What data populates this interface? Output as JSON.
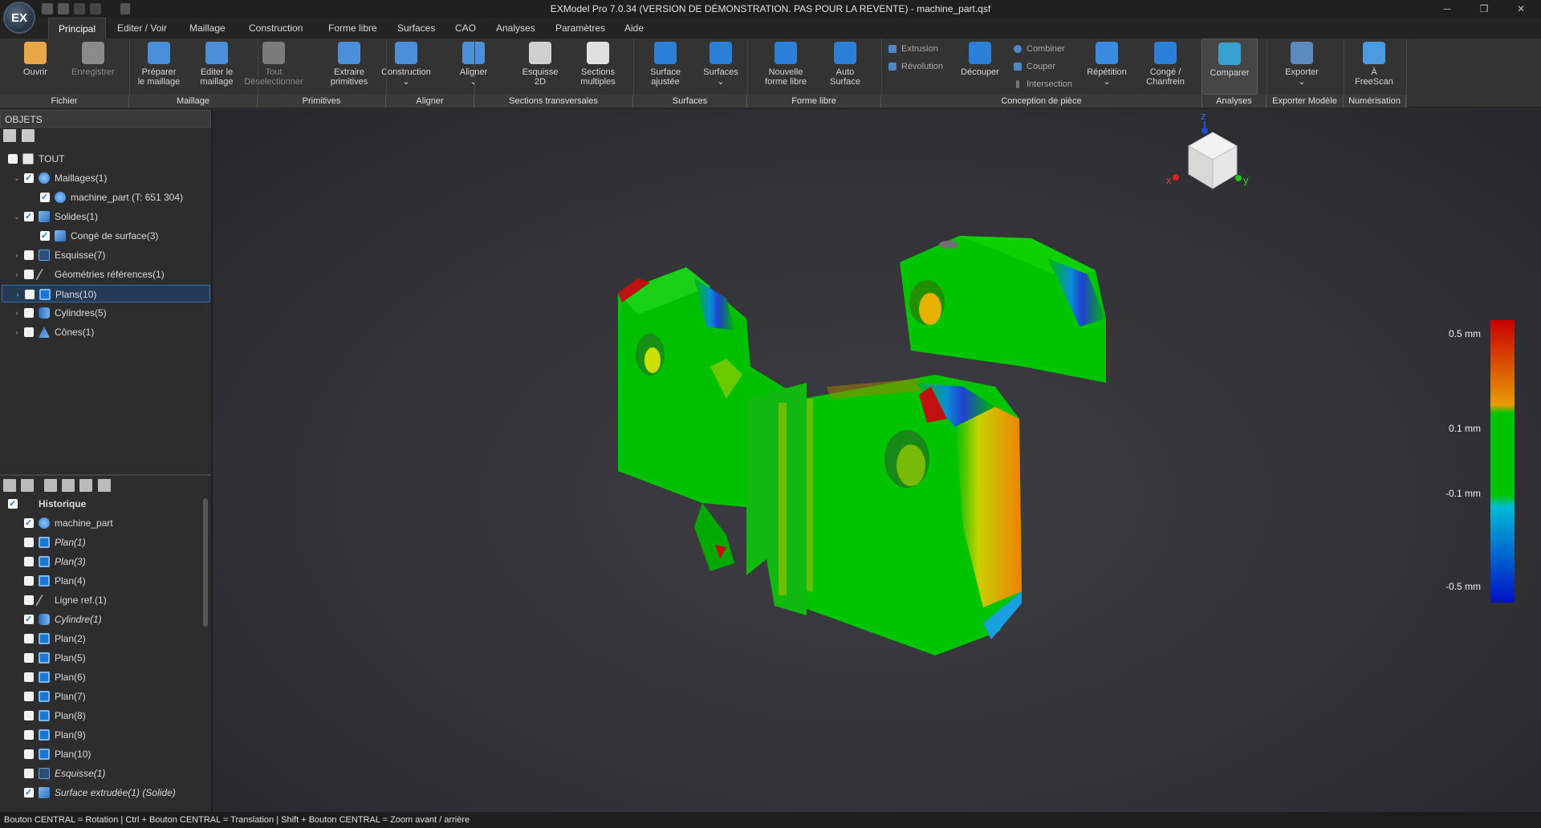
{
  "window": {
    "title": "EXModel Pro 7.0.34 (VERSION DE DÉMONSTRATION. PAS POUR LA REVENTE) - machine_part.qsf",
    "logo_text": "EX"
  },
  "menu": {
    "tabs": [
      "Principal",
      "Editer / Voir",
      "Maillage",
      "Construction",
      "Forme libre",
      "Surfaces",
      "CAO",
      "Analyses",
      "Paramètres",
      "Aide"
    ],
    "active": "Principal"
  },
  "ribbon": {
    "buttons": [
      {
        "label1": "Ouvrir",
        "label2": "",
        "icon": "folder-icon",
        "color": "#e8a84a"
      },
      {
        "label1": "Enregistrer",
        "label2": "",
        "icon": "save-icon",
        "color": "#8a8a8a"
      },
      {
        "label1": "Préparer",
        "label2": "le maillage",
        "icon": "mesh-prepare-icon",
        "color": "#4a8fd8"
      },
      {
        "label1": "Editer le",
        "label2": "maillage",
        "icon": "mesh-edit-icon",
        "color": "#4a8fd8"
      },
      {
        "label1": "Tout",
        "label2": "Déselectionner",
        "icon": "deselect-icon",
        "color": "#7a7a7a"
      },
      {
        "label1": "Extraire",
        "label2": "primitives",
        "icon": "primitives-icon",
        "color": "#4a8fd8"
      },
      {
        "label1": "Construction",
        "label2": "⌄",
        "icon": "construction-icon",
        "color": "#4a8fd8"
      },
      {
        "label1": "Aligner",
        "label2": "⌄",
        "icon": "align-icon",
        "color": "#4a8fd8"
      },
      {
        "label1": "Esquisse",
        "label2": "2D",
        "icon": "sketch-icon",
        "color": "#cfcfcf"
      },
      {
        "label1": "Sections",
        "label2": "multiples",
        "icon": "sections-icon",
        "color": "#e0e0e0"
      },
      {
        "label1": "Surface",
        "label2": "ajustée",
        "icon": "fit-surface-icon",
        "color": "#2c7fd6"
      },
      {
        "label1": "Surfaces",
        "label2": "⌄",
        "icon": "surfaces-icon",
        "color": "#2c7fd6"
      },
      {
        "label1": "Nouvelle",
        "label2": "forme libre",
        "icon": "freeform-icon",
        "color": "#2c7fd6"
      },
      {
        "label1": "Auto",
        "label2": "Surface",
        "icon": "auto-surface-icon",
        "color": "#2c7fd6"
      },
      {
        "label1": "Découper",
        "label2": "",
        "icon": "cut-icon",
        "color": "#2c7fd6"
      },
      {
        "label1": "Répétition",
        "label2": "⌄",
        "icon": "pattern-icon",
        "color": "#3a8ae0"
      },
      {
        "label1": "Congé /",
        "label2": "Chanfrein",
        "icon": "fillet-icon",
        "color": "#2c7fd6"
      },
      {
        "label1": "Comparer",
        "label2": "",
        "icon": "compare-icon",
        "color": "#3aa0d0"
      },
      {
        "label1": "Exporter",
        "label2": "⌄",
        "icon": "export-icon",
        "color": "#5a8ac0"
      },
      {
        "label1": "À",
        "label2": "FreeScan",
        "icon": "freescan-icon",
        "color": "#4a9be0"
      }
    ],
    "small": {
      "extrusion": "Extrusion",
      "revolution": "Révolution",
      "combiner": "Combiner",
      "couper": "Couper",
      "intersection": "Intersection"
    },
    "groups": [
      "Fichier",
      "Maillage",
      "Primitives",
      "Aligner",
      "Sections transversales",
      "Surfaces",
      "Forme libre",
      "Conception de pièce",
      "Analyses",
      "Exporter Modèle",
      "Numérisation"
    ]
  },
  "objects": {
    "header": "OBJETS",
    "items": [
      {
        "label": "TOUT",
        "icon": "all-icon",
        "checked": false,
        "arrow": "",
        "indent": 0
      },
      {
        "label": "Maillages(1)",
        "icon": "mesh-icon",
        "checked": true,
        "arrow": "⌄",
        "indent": 1
      },
      {
        "label": "machine_part (T: 651 304)",
        "icon": "mesh-icon",
        "checked": true,
        "arrow": "",
        "indent": 2
      },
      {
        "label": "Solides(1)",
        "icon": "solid-icon",
        "checked": true,
        "arrow": "⌄",
        "indent": 1
      },
      {
        "label": "Congé de surface(3)",
        "icon": "solid-icon",
        "checked": true,
        "arrow": "",
        "indent": 2
      },
      {
        "label": "Esquisse(7)",
        "icon": "sketch-icon",
        "checked": false,
        "arrow": "›",
        "indent": 1
      },
      {
        "label": "Géométries références(1)",
        "icon": "reference-icon",
        "checked": false,
        "arrow": "›",
        "indent": 1
      },
      {
        "label": "Plans(10)",
        "icon": "plane-icon",
        "checked": false,
        "arrow": "›",
        "indent": 1,
        "selected": true
      },
      {
        "label": "Cylindres(5)",
        "icon": "cylinder-icon",
        "checked": false,
        "arrow": "›",
        "indent": 1
      },
      {
        "label": "Cônes(1)",
        "icon": "cone-icon",
        "checked": false,
        "arrow": "›",
        "indent": 1
      }
    ]
  },
  "history": {
    "header": "Historique",
    "items": [
      {
        "label": "machine_part",
        "icon": "mesh-icon",
        "checked": true,
        "italic": false
      },
      {
        "label": "Plan(1)",
        "icon": "plane-icon",
        "checked": false,
        "italic": true
      },
      {
        "label": "Plan(3)",
        "icon": "plane-icon",
        "checked": false,
        "italic": true
      },
      {
        "label": "Plan(4)",
        "icon": "plane-icon",
        "checked": false,
        "italic": false
      },
      {
        "label": "Ligne ref.(1)",
        "icon": "reference-icon",
        "checked": false,
        "italic": false
      },
      {
        "label": "Cylindre(1)",
        "icon": "cylinder-icon",
        "checked": true,
        "italic": true
      },
      {
        "label": "Plan(2)",
        "icon": "plane-icon",
        "checked": false,
        "italic": false
      },
      {
        "label": "Plan(5)",
        "icon": "plane-icon",
        "checked": false,
        "italic": false
      },
      {
        "label": "Plan(6)",
        "icon": "plane-icon",
        "checked": false,
        "italic": false
      },
      {
        "label": "Plan(7)",
        "icon": "plane-icon",
        "checked": false,
        "italic": false
      },
      {
        "label": "Plan(8)",
        "icon": "plane-icon",
        "checked": false,
        "italic": false
      },
      {
        "label": "Plan(9)",
        "icon": "plane-icon",
        "checked": false,
        "italic": false
      },
      {
        "label": "Plan(10)",
        "icon": "plane-icon",
        "checked": false,
        "italic": false
      },
      {
        "label": "Esquisse(1)",
        "icon": "sketch-icon",
        "checked": false,
        "italic": true
      },
      {
        "label": "Surface extrudée(1) (Solide)",
        "icon": "extrude-icon",
        "checked": true,
        "italic": true
      }
    ]
  },
  "viewport": {
    "axes": {
      "x": "x",
      "y": "y",
      "z": "z"
    },
    "legend": {
      "labels": [
        "0.5 mm",
        "0.1 mm",
        "-0.1 mm",
        "-0.5 mm"
      ],
      "colors": [
        "#c80000",
        "#e89a00",
        "#00c400",
        "#00bcd4",
        "#0010c8"
      ]
    }
  },
  "status": {
    "text": "Bouton CENTRAL = Rotation | Ctrl + Bouton CENTRAL = Translation | Shift + Bouton CENTRAL = Zoom avant / arrière"
  }
}
